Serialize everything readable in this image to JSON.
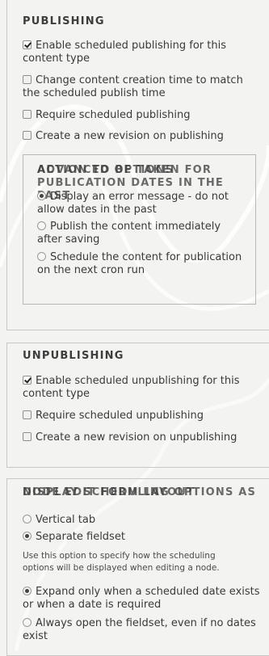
{
  "publishing": {
    "legend": "PUBLISHING",
    "options": [
      {
        "label": "Enable scheduled publishing for this content type",
        "checked": true
      },
      {
        "label": "Change content creation time to match the scheduled publish time",
        "checked": false
      },
      {
        "label": "Require scheduled publishing",
        "checked": false
      },
      {
        "label": "Create a new revision on publishing",
        "checked": false
      }
    ],
    "advanced": {
      "legend_a": "ADVANCED OPTIONS",
      "legend_b": "ACTION TO BE TAKEN FOR PUBLICATION DATES IN THE PAST",
      "options": [
        {
          "label": "Display an error message - do not allow dates in the past",
          "selected": true
        },
        {
          "label": "Publish the content immediately after saving",
          "selected": false
        },
        {
          "label": "Schedule the content for publication on the next cron run",
          "selected": false
        }
      ]
    }
  },
  "unpublishing": {
    "legend": "UNPUBLISHING",
    "options": [
      {
        "label": "Enable scheduled unpublishing for this content type",
        "checked": true
      },
      {
        "label": "Require scheduled unpublishing",
        "checked": false
      },
      {
        "label": "Create a new revision on unpublishing",
        "checked": false
      }
    ]
  },
  "node_form": {
    "legend_a": "NODE EDIT FORM LAYOUT",
    "legend_b": "DISPLAY SCHEDULING OPTIONS AS",
    "display_options": [
      {
        "label": "Vertical tab",
        "selected": false
      },
      {
        "label": "Separate fieldset",
        "selected": true
      }
    ],
    "description": "Use this option to specify how the scheduling options will be displayed when editing a node.",
    "expand_options": [
      {
        "label": "Expand only when a scheduled date exists or when a date is required",
        "selected": true
      },
      {
        "label": "Always open the fieldset, even if no dates exist",
        "selected": false
      }
    ]
  }
}
